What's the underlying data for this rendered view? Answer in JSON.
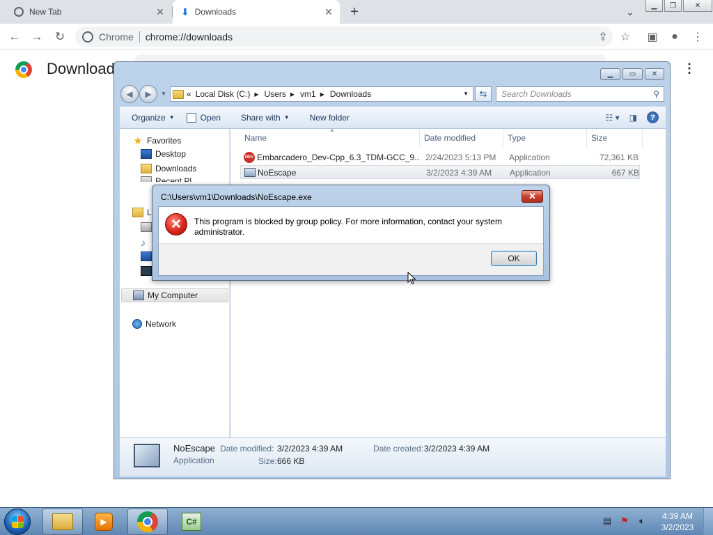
{
  "browser": {
    "tabs": [
      {
        "title": "New Tab",
        "icon": "chrome-icon",
        "active": false
      },
      {
        "title": "Downloads",
        "icon": "download-icon",
        "active": true
      }
    ],
    "site_name": "Chrome",
    "url": "chrome://downloads",
    "page_title": "Downloads"
  },
  "explorer": {
    "breadcrumb": [
      "Local Disk (C:)",
      "Users",
      "vm1",
      "Downloads"
    ],
    "search_placeholder": "Search Downloads",
    "commands": {
      "organize": "Organize",
      "open": "Open",
      "share_with": "Share with",
      "new_folder": "New folder"
    },
    "nav": {
      "favorites": "Favorites",
      "desktop": "Desktop",
      "downloads": "Downloads",
      "recent_places_partial": "Recent Pl",
      "libraries_partial": "L",
      "my_computer": "My Computer",
      "network": "Network"
    },
    "columns": {
      "name": "Name",
      "date": "Date modified",
      "type": "Type",
      "size": "Size"
    },
    "files": [
      {
        "name": "Embarcadero_Dev-Cpp_6.3_TDM-GCC_9....",
        "date": "2/24/2023 5:13 PM",
        "type": "Application",
        "size": "72,361 KB",
        "icon": "devcpp-icon"
      },
      {
        "name": "NoEscape",
        "date": "3/2/2023 4:39 AM",
        "type": "Application",
        "size": "667 KB",
        "icon": "application-icon"
      }
    ],
    "details": {
      "name": "NoEscape",
      "type": "Application",
      "date_modified_label": "Date modified:",
      "date_modified": "3/2/2023 4:39 AM",
      "date_created_label": "Date created:",
      "date_created": "3/2/2023 4:39 AM",
      "size_label": "Size:",
      "size": "666 KB"
    }
  },
  "dialog": {
    "title": "C:\\Users\\vm1\\Downloads\\NoEscape.exe",
    "message": "This program is blocked by group policy. For more information, contact your system administrator.",
    "ok_label": "OK"
  },
  "taskbar": {
    "time": "4:39 AM",
    "date": "3/2/2023",
    "apps": [
      "explorer-icon",
      "media-player-icon",
      "chrome-icon",
      "csharp-icon"
    ]
  }
}
